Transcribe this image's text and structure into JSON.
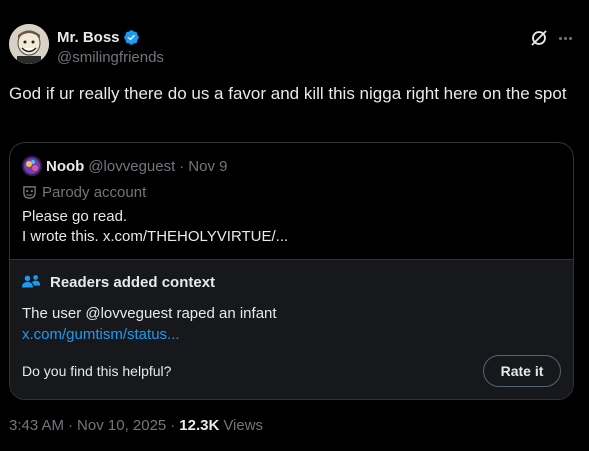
{
  "author": {
    "display_name": "Mr. Boss",
    "handle": "@smilingfriends",
    "verified_color": "#1d9bf0"
  },
  "header_icons": [
    "grok-icon",
    "more-icon"
  ],
  "tweet": {
    "text": "God if ur really there do us a favor and kill this nigga right here on the spot"
  },
  "quote": {
    "display_name": "Noob",
    "handle": "@lovveguest",
    "separator": "·",
    "date": "Nov 9",
    "parody_label": "Parody account",
    "body_line1": "Please go read.",
    "body_line2": "I wrote this. x.com/THEHOLYVIRTUE/..."
  },
  "community_note": {
    "title": "Readers added context",
    "text": "The user @lovveguest raped an infant",
    "link": "x.com/gumtism/status...",
    "helpful_question": "Do you find this helpful?",
    "rate_label": "Rate it"
  },
  "meta": {
    "time": "3:43 AM",
    "dot1": "·",
    "date": "Nov 10, 2025",
    "dot2": "·",
    "views_count": "12.3K",
    "views_label": "Views"
  },
  "colors": {
    "background": "#000000",
    "text": "#e7e9ea",
    "muted": "#71767b",
    "link": "#1d9bf0",
    "border": "#2f3336",
    "note_bg": "#16181c"
  }
}
